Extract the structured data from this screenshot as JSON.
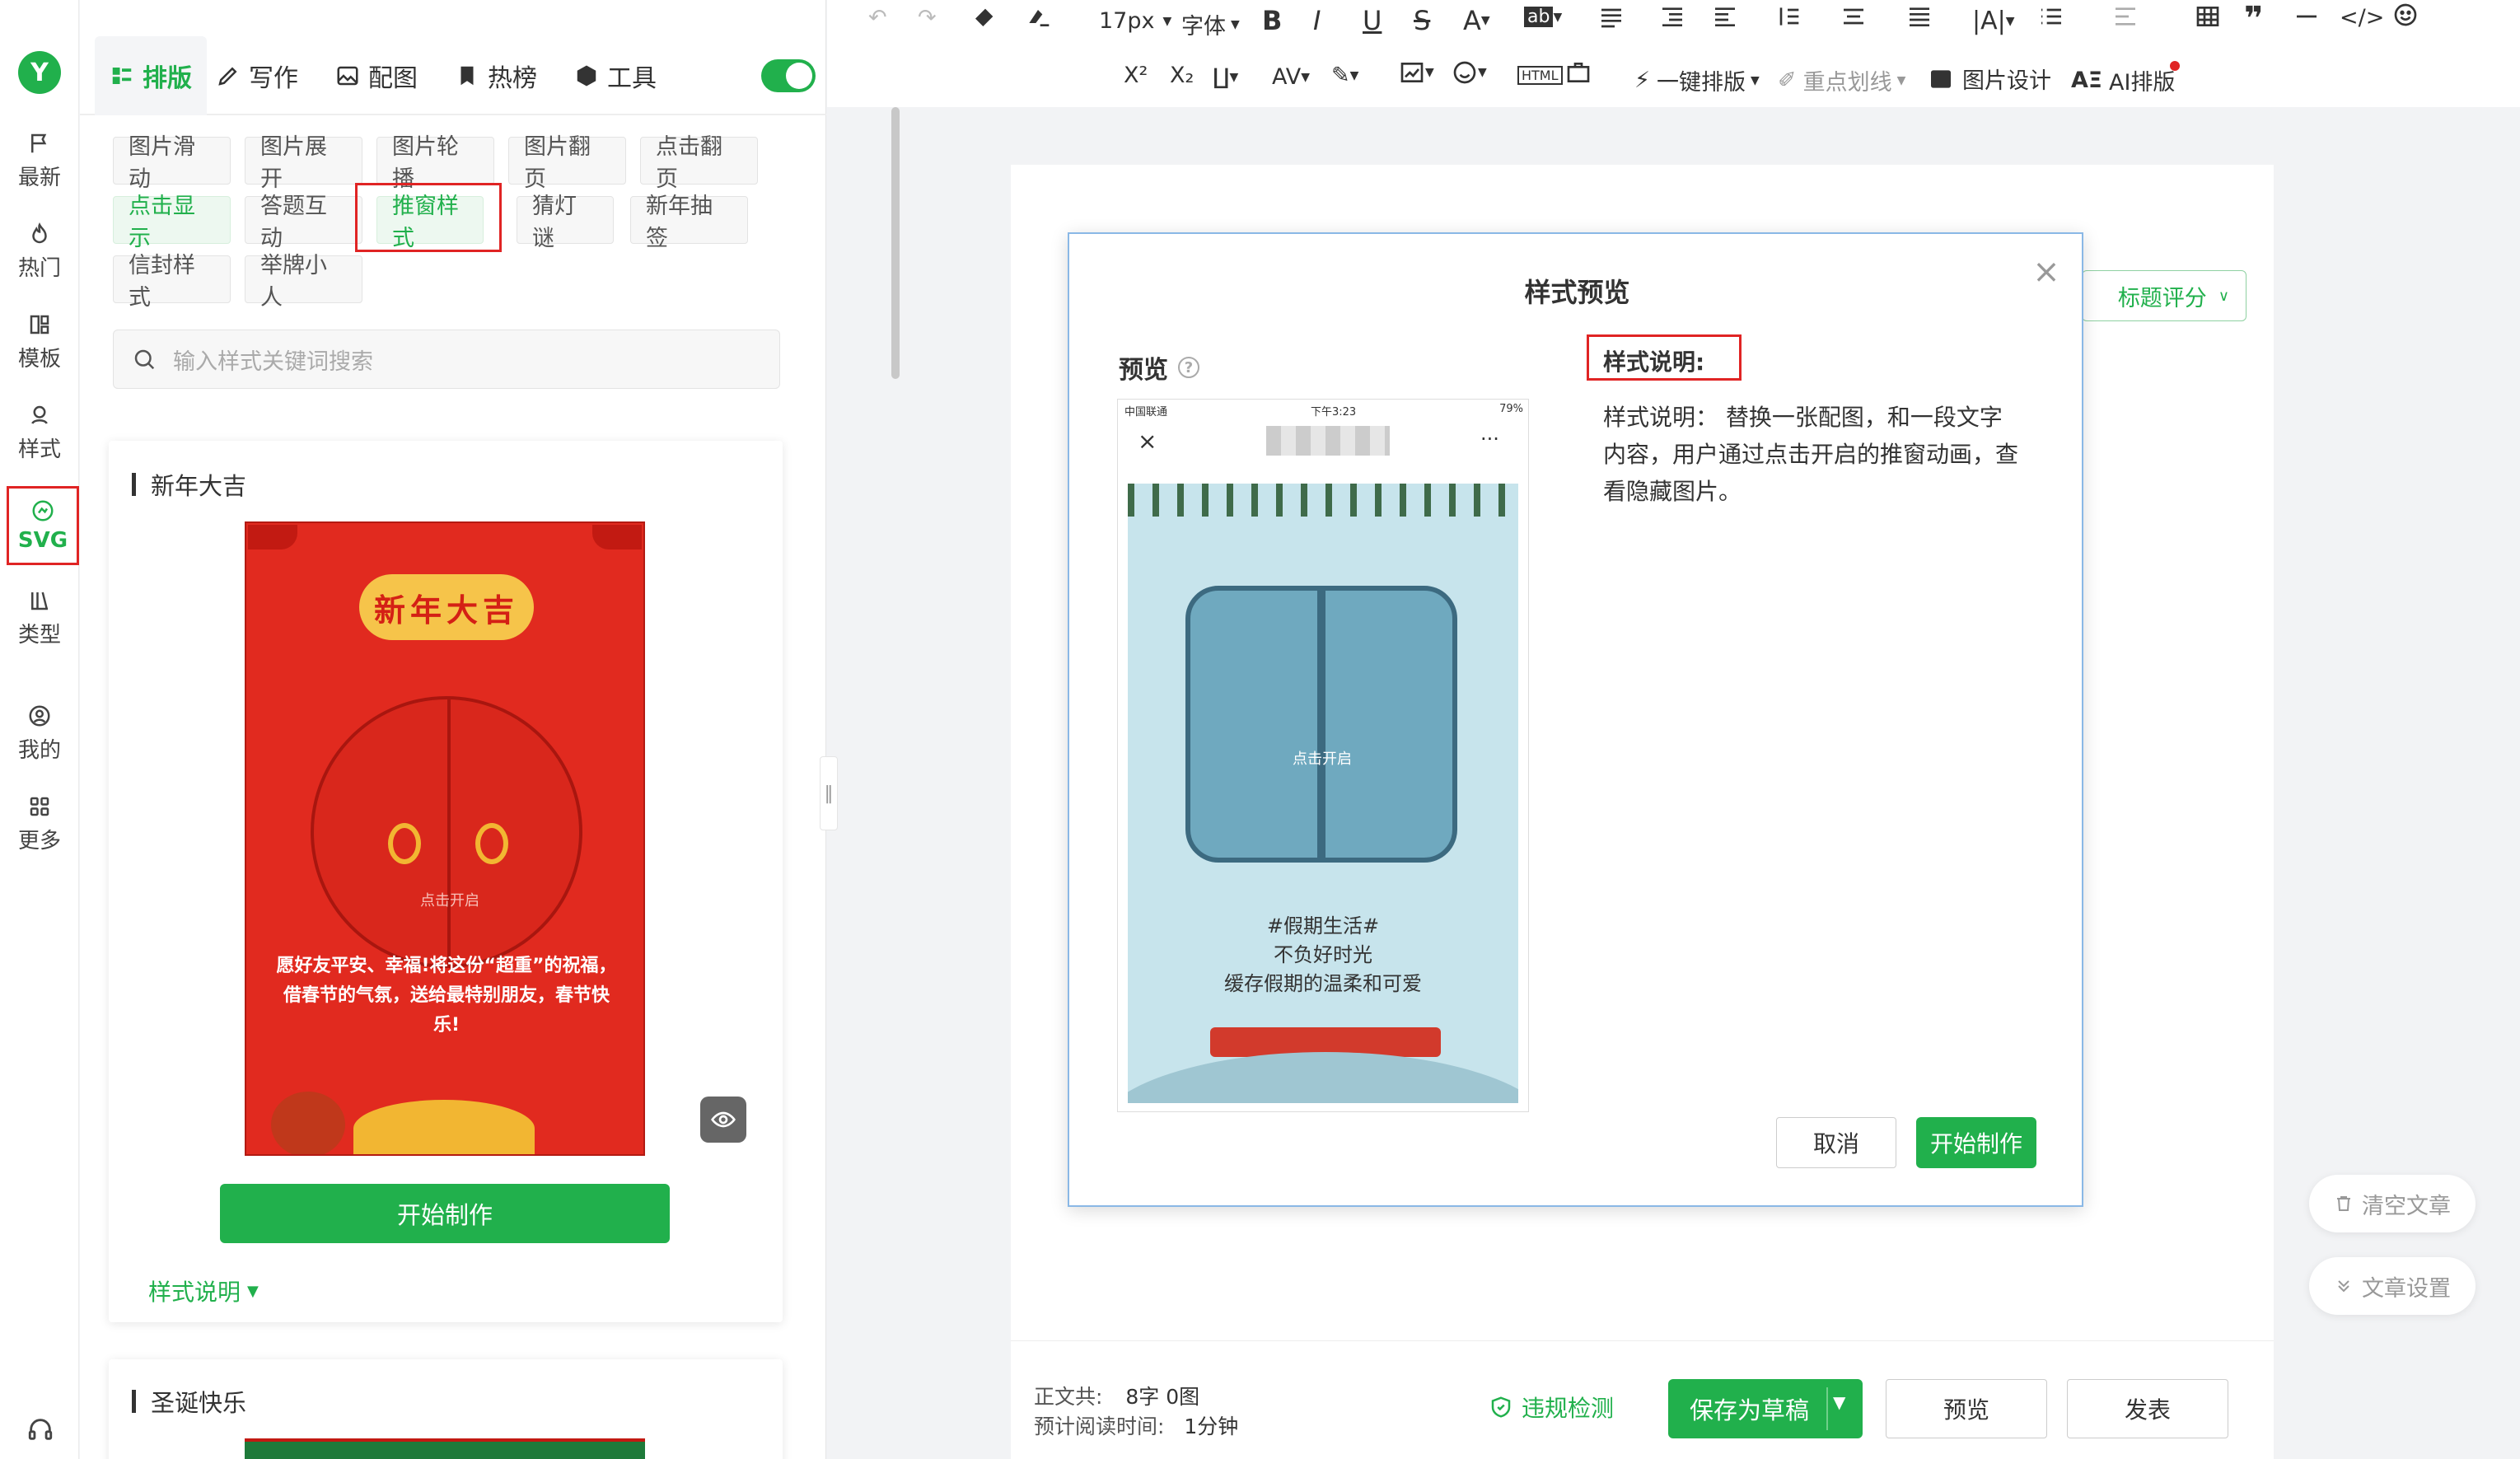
{
  "rail": {
    "logo": "Y",
    "items": [
      {
        "label": "最新",
        "icon": "flag-icon"
      },
      {
        "label": "热门",
        "icon": "flame-icon"
      },
      {
        "label": "模板",
        "icon": "template-icon"
      },
      {
        "label": "样式",
        "icon": "style-icon"
      },
      {
        "label": "SVG",
        "icon": "svg-icon"
      },
      {
        "label": "类型",
        "icon": "books-icon"
      },
      {
        "label": "我的",
        "icon": "user-icon"
      },
      {
        "label": "更多",
        "icon": "grid-icon"
      }
    ]
  },
  "tabs": [
    "排版",
    "写作",
    "配图",
    "热榜",
    "工具"
  ],
  "chips": [
    "图片滑动",
    "图片展开",
    "图片轮播",
    "图片翻页",
    "点击翻页",
    "点击显示",
    "答题互动",
    "推窗样式",
    "猜灯谜",
    "新年抽签",
    "信封样式",
    "举牌小人"
  ],
  "search": {
    "placeholder": "输入样式关键词搜索"
  },
  "card1": {
    "title": "新年大吉",
    "banner": "新年大吉",
    "tap_hint": "点击开启",
    "greeting": "愿好友平安、幸福!将这份“超重”的祝福，借春节的气氛，送给最特别朋友，春节快乐!",
    "start_label": "开始制作",
    "desc_label": "样式说明"
  },
  "card2": {
    "title": "圣诞快乐"
  },
  "toolbar": {
    "font_size": "17px",
    "font_family": "字体",
    "one_click": "一键排版",
    "underline": "重点划线",
    "image_design": "图片设计",
    "ai_layout": "AI排版",
    "accent": "#21b04c"
  },
  "dialog": {
    "title": "样式预览",
    "preview_label": "预览",
    "desc_heading": "样式说明:",
    "desc_text": "样式说明： 替换一张配图，和一段文字内容，用户通过点击开启的推窗动画，查看隐藏图片。",
    "cancel_label": "取消",
    "start_label": "开始制作",
    "phone": {
      "carrier": "中国联通",
      "time": "下午3:23",
      "battery": "79%",
      "tap_hint": "点击开启",
      "line1": "#假期生活#",
      "line2": "不负好时光",
      "line3": "缓存假期的温柔和可爱"
    }
  },
  "title_score": "标题评分",
  "side": {
    "clear": "清空文章",
    "settings": "文章设置"
  },
  "footer": {
    "count_label": "正文共:",
    "count_value": "8字 0图",
    "read_label": "预计阅读时间:",
    "read_value": "1分钟",
    "check_label": "违规检测",
    "save_label": "保存为草稿",
    "preview_label": "预览",
    "publish_label": "发表"
  }
}
